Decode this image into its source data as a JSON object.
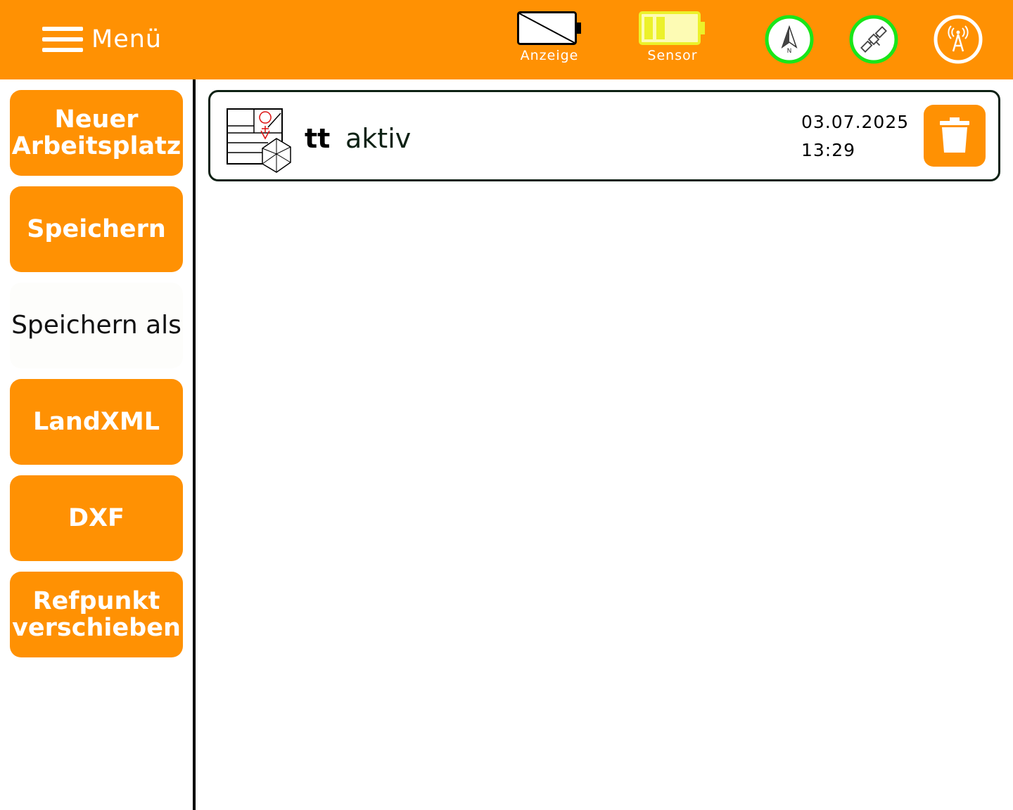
{
  "header": {
    "menu_label": "Menü",
    "display_battery_label": "Anzeige",
    "sensor_battery_label": "Sensor",
    "icons": [
      "compass-north-icon",
      "satellite-icon",
      "radio-tower-icon"
    ],
    "status_ok_color": "#19e619",
    "accent_color": "#ff9103"
  },
  "sidebar": {
    "items": [
      {
        "label_line1": "Neuer",
        "label_line2": "Arbeitsplatz"
      },
      {
        "label": "Speichern"
      },
      {
        "label": "Speichern als"
      },
      {
        "label": "LandXML"
      },
      {
        "label": "DXF"
      },
      {
        "label_line1": "Refpunkt",
        "label_line2": "verschieben"
      }
    ]
  },
  "worksites": [
    {
      "name": "tt",
      "status": "aktiv",
      "date": "03.07.2025",
      "time": "13:29"
    }
  ]
}
